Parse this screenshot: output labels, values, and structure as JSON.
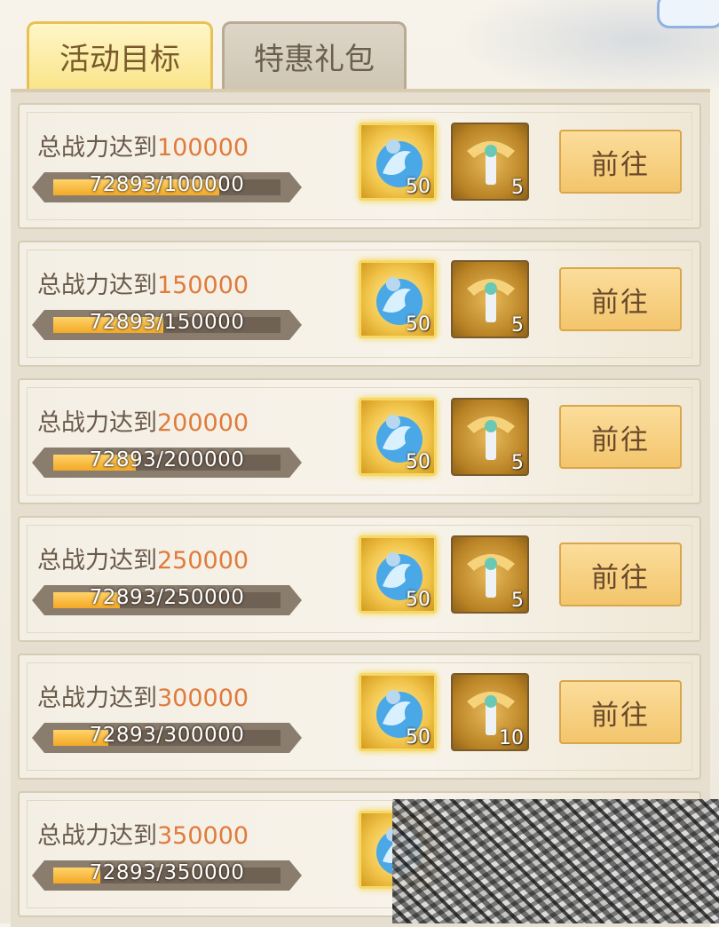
{
  "tabs": [
    {
      "label": "活动目标",
      "active": true
    },
    {
      "label": "特惠礼包",
      "active": false
    }
  ],
  "goal_prefix": "总战力达到",
  "go_label": "前往",
  "current_power": 72893,
  "rows": [
    {
      "target": "100000",
      "progress": "72893/100000",
      "fraction": 0.729,
      "reward1_count": "50",
      "reward2_count": "5"
    },
    {
      "target": "150000",
      "progress": "72893/150000",
      "fraction": 0.486,
      "reward1_count": "50",
      "reward2_count": "5"
    },
    {
      "target": "200000",
      "progress": "72893/200000",
      "fraction": 0.364,
      "reward1_count": "50",
      "reward2_count": "5"
    },
    {
      "target": "250000",
      "progress": "72893/250000",
      "fraction": 0.292,
      "reward1_count": "50",
      "reward2_count": "5"
    },
    {
      "target": "300000",
      "progress": "72893/300000",
      "fraction": 0.243,
      "reward1_count": "50",
      "reward2_count": "10"
    },
    {
      "target": "350000",
      "progress": "72893/350000",
      "fraction": 0.208,
      "reward1_count": "",
      "reward2_count": ""
    }
  ],
  "colors": {
    "target_number": "#e07b3c",
    "progress_fill": "#f3a925",
    "button": "#f3c56c"
  },
  "icons": {
    "reward1": "blue-wave-orb-icon",
    "reward2": "golden-sword-emblem-icon"
  }
}
